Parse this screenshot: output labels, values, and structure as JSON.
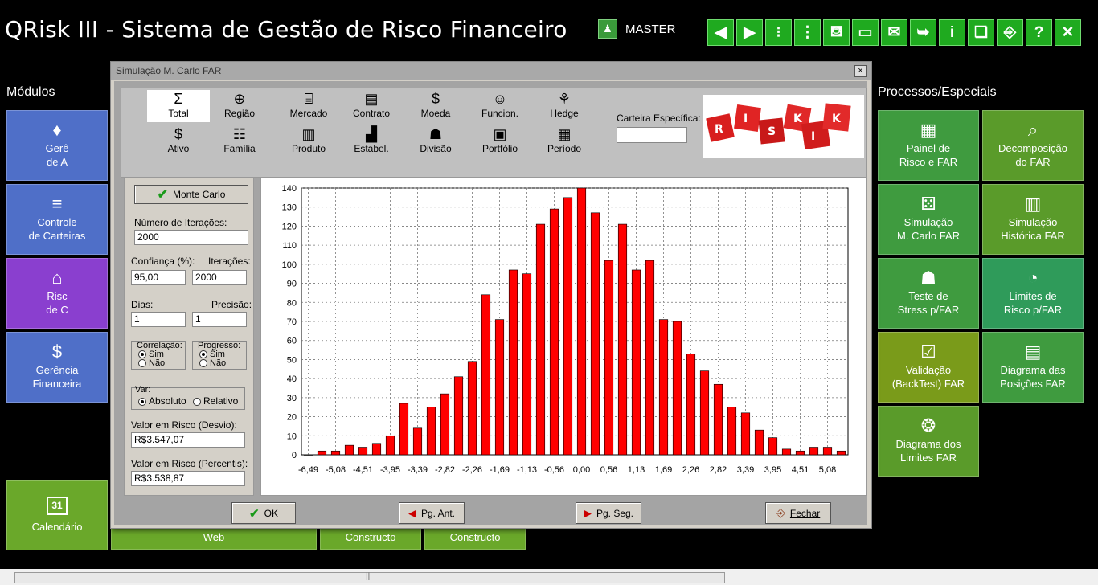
{
  "app": {
    "title": "QRisk III - Sistema de Gestão de Risco Financeiro",
    "user": "MASTER"
  },
  "toolbar": [
    {
      "name": "back-arrow-icon",
      "glyph": "◀"
    },
    {
      "name": "forward-arrow-icon",
      "glyph": "▶"
    },
    {
      "name": "traffic-light-icon",
      "glyph": "⁝"
    },
    {
      "name": "traffic-light-vertical-icon",
      "glyph": "⋮"
    },
    {
      "name": "paint-bucket-icon",
      "glyph": "⛾"
    },
    {
      "name": "monitor-icon",
      "glyph": "▭"
    },
    {
      "name": "email-icon",
      "glyph": "✉"
    },
    {
      "name": "send-icon",
      "glyph": "➥"
    },
    {
      "name": "info-icon",
      "glyph": "i"
    },
    {
      "name": "document-settings-icon",
      "glyph": "❏"
    },
    {
      "name": "exit-door-icon",
      "glyph": "⎆"
    },
    {
      "name": "help-icon",
      "glyph": "?"
    },
    {
      "name": "close-icon",
      "glyph": "✕"
    }
  ],
  "left_section": {
    "label": "Módulos"
  },
  "left_tiles": [
    {
      "name": "gerencia-ativos",
      "line1": "Gerê",
      "line2": "de A",
      "icon": "♦",
      "color": "#4f6fc8"
    },
    {
      "name": "controle-carteiras",
      "line1": "Controle",
      "line2": "de Carteiras",
      "icon": "≡",
      "color": "#4f6fc8"
    },
    {
      "name": "risco",
      "line1": "Risc",
      "line2": "de  C",
      "icon": "⌂",
      "color": "#8a3fcf"
    },
    {
      "name": "gerencia-financeira",
      "line1": "Gerência",
      "line2": "Financeira",
      "icon": "$",
      "color": "#4f6fc8"
    }
  ],
  "calendar_tile": {
    "label": "Calendário",
    "icon": "31"
  },
  "bottom_tiles": [
    "Web",
    "Constructo",
    "Constructo"
  ],
  "right_section": {
    "label": "Processos/Especiais"
  },
  "right_tiles": [
    {
      "name": "painel-risco-far",
      "line1": "Painel de",
      "line2": "Risco e FAR",
      "icon": "▦",
      "color": "#3f9b3f"
    },
    {
      "name": "decomposicao-far",
      "line1": "Decomposição",
      "line2": "do FAR",
      "icon": "⌕",
      "color": "#5a9b2a"
    },
    {
      "name": "simulacao-monte-carlo-far",
      "line1": "Simulação",
      "line2": "M. Carlo FAR",
      "icon": "⚄",
      "color": "#3f9b3f"
    },
    {
      "name": "simulacao-historica-far",
      "line1": "Simulação",
      "line2": "Histórica FAR",
      "icon": "▥",
      "color": "#5a9b2a"
    },
    {
      "name": "teste-stress-far",
      "line1": "Teste de",
      "line2": "Stress p/FAR",
      "icon": "☗",
      "color": "#3f9b3f"
    },
    {
      "name": "limites-risco-far",
      "line1": "Limites de",
      "line2": "Risco p/FAR",
      "icon": "◔",
      "color": "#2f9b5a"
    },
    {
      "name": "validacao-backtest-far",
      "line1": "Validação",
      "line2": "(BackTest) FAR",
      "icon": "☑",
      "color": "#7a9b1a"
    },
    {
      "name": "diagrama-posicoes-far",
      "line1": "Diagrama das",
      "line2": "Posições FAR",
      "icon": "▤",
      "color": "#3f9b3f"
    },
    {
      "name": "diagrama-limites-far",
      "line1": "Diagrama dos",
      "line2": "Limites FAR",
      "icon": "❂",
      "color": "#5a9b2a"
    }
  ],
  "dialog": {
    "title": "Simulação M. Carlo FAR",
    "dimensions_row1": [
      {
        "label": "Total",
        "icon": "Σ",
        "selected": true
      },
      {
        "label": "Região",
        "icon": "⊕"
      },
      {
        "label": "Mercado",
        "icon": "⌸"
      },
      {
        "label": "Contrato",
        "icon": "▤"
      },
      {
        "label": "Moeda",
        "icon": "$"
      },
      {
        "label": "Funcion.",
        "icon": "☺"
      },
      {
        "label": "Hedge",
        "icon": "⚘"
      }
    ],
    "dimensions_row2": [
      {
        "label": "Ativo",
        "icon": "$"
      },
      {
        "label": "Família",
        "icon": "☷"
      },
      {
        "label": "Produto",
        "icon": "▥"
      },
      {
        "label": "Estabel.",
        "icon": "▟"
      },
      {
        "label": "Divisão",
        "icon": "☗"
      },
      {
        "label": "Portfólio",
        "icon": "▣"
      },
      {
        "label": "Período",
        "icon": "▦"
      }
    ],
    "carteira_label": "Carteira Específica:",
    "carteira_value": "",
    "risk_letters": [
      "R",
      "I",
      "S",
      "K",
      "R",
      "I",
      "S",
      "K"
    ],
    "monte_carlo_button": "Monte Carlo",
    "num_iteracoes_label": "Número de Iterações:",
    "num_iteracoes_value": "2000",
    "confianca_label": "Confiança (%):",
    "confianca_value": "95,00",
    "iteracoes_label": "Iterações:",
    "iteracoes_value": "2000",
    "dias_label": "Dias:",
    "dias_value": "1",
    "precisao_label": "Precisão:",
    "precisao_value": "1",
    "correlacao_label": "Correlação:",
    "progresso_label": "Progresso:",
    "sim_label": "Sim",
    "nao_label": "Não",
    "var_label": "Var:",
    "absoluto_label": "Absoluto",
    "relativo_label": "Relativo",
    "var_desvio_label": "Valor em Risco (Desvio):",
    "var_desvio_value": "R$3.547,07",
    "var_percentis_label": "Valor em Risco (Percentis):",
    "var_percentis_value": "R$3.538,87",
    "ok_button": "OK",
    "prev_button": "Pg. Ant.",
    "next_button": "Pg. Seg.",
    "close_button": "Fechar"
  },
  "chart_data": {
    "type": "bar",
    "bar_color": "#ff0000",
    "x_tick_labels": [
      "-6,49",
      "-5,08",
      "-4,51",
      "-3,95",
      "-3,39",
      "-2,82",
      "-2,26",
      "-1,69",
      "-1,13",
      "-0,56",
      "0,00",
      "0,56",
      "1,13",
      "1,69",
      "2,26",
      "2,82",
      "3,39",
      "3,95",
      "4,51",
      "5,08"
    ],
    "values": [
      0,
      2,
      2,
      5,
      4,
      6,
      10,
      27,
      14,
      25,
      32,
      41,
      49,
      84,
      71,
      97,
      95,
      121,
      129,
      135,
      140,
      127,
      102,
      121,
      97,
      102,
      71,
      70,
      53,
      44,
      37,
      25,
      22,
      13,
      9,
      3,
      2,
      4,
      4,
      2
    ],
    "ylim": [
      0,
      140
    ],
    "y_ticks": [
      0,
      10,
      20,
      30,
      40,
      50,
      60,
      70,
      80,
      90,
      100,
      110,
      120,
      130,
      140
    ],
    "grid": true
  }
}
